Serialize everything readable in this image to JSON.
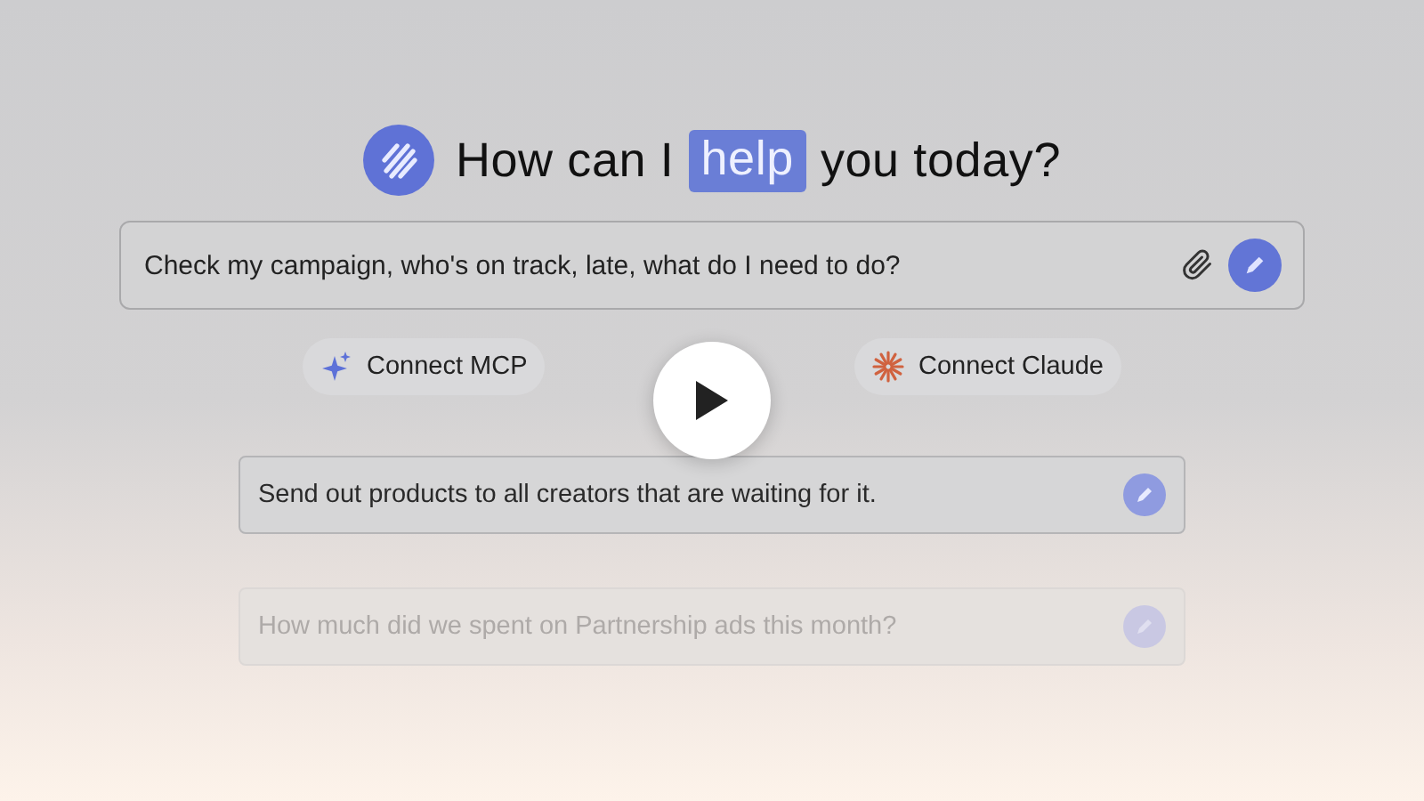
{
  "heading": {
    "before": "How can I",
    "highlight": "help",
    "after": "you today?"
  },
  "prompt": {
    "value": "Check my campaign, who's on track, late, what do I need to do?"
  },
  "connect_buttons": [
    {
      "kind": "mcp",
      "label": "Connect MCP"
    },
    {
      "kind": "claude",
      "label": "Connect Claude"
    }
  ],
  "suggestions": [
    {
      "text": "Send out products to all creators that are waiting for it.",
      "dimmed": false
    },
    {
      "text": "How much did we spent on Partnership ads this month?",
      "dimmed": true
    }
  ]
}
